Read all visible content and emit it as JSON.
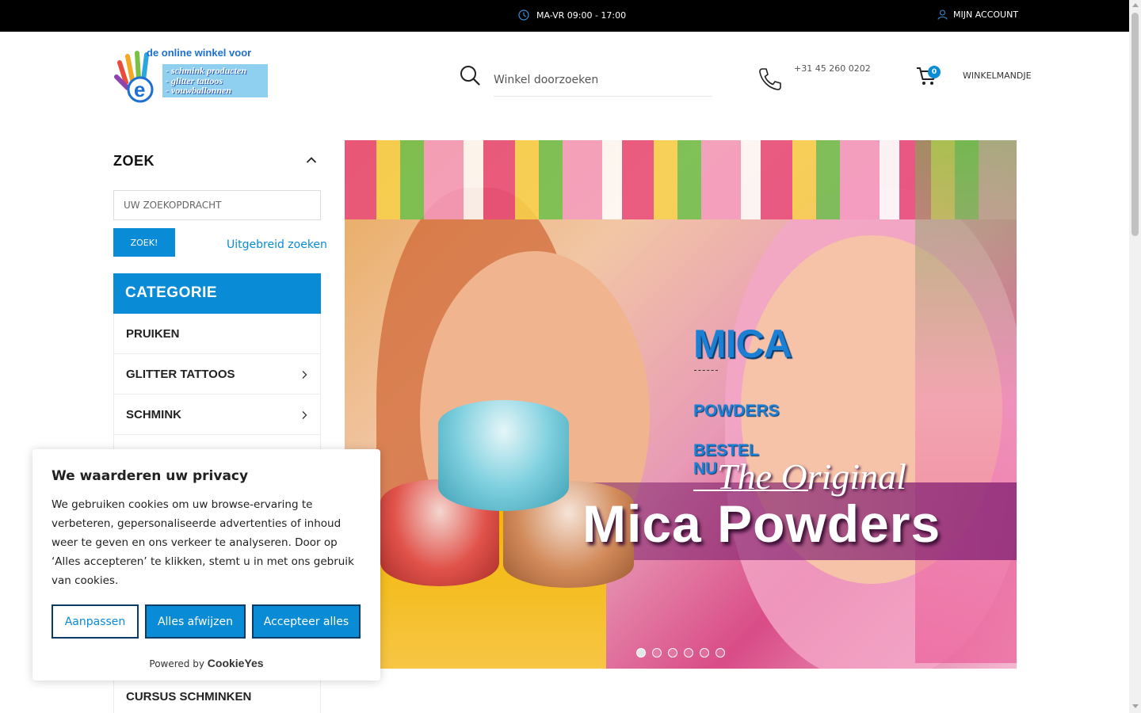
{
  "topbar": {
    "hours": "MA-VR 09:00 - 17:00",
    "account": "MIJN ACCOUNT"
  },
  "header": {
    "logo_tagline": "de online winkel voor",
    "logo_lines": [
      "- schmink producten",
      "- glitter tattoos",
      "- vouwballonnen"
    ],
    "search_placeholder": "Winkel doorzoeken",
    "phone": "+31 45 260 0202",
    "cart_count": "0",
    "cart_label": "WINKELMANDJE"
  },
  "sidebar": {
    "zoek_title": "ZOEK",
    "search_placeholder": "UW ZOEKOPDRACHT",
    "search_button": "ZOEK!",
    "advanced_link": "Uitgebreid zoeken",
    "category_title": "CATEGORIE",
    "categories": [
      {
        "label": "PRUIKEN",
        "has_children": false
      },
      {
        "label": "GLITTER TATTOOS",
        "has_children": true
      },
      {
        "label": "SCHMINK",
        "has_children": true
      }
    ],
    "last_category": "CURSUS SCHMINKEN"
  },
  "hero": {
    "headline": "MICA",
    "subline": "POWDERS",
    "cta": "BESTEL NU",
    "script_text": "The Original",
    "big_text": "Mica Powders",
    "slide_count": 6,
    "active_slide": 1
  },
  "cookie": {
    "title": "We waarderen uw privacy",
    "body": "We gebruiken cookies om uw browse-ervaring te verbeteren, gepersonaliseerde advertenties of inhoud weer te geven en ons verkeer te analyseren. Door op ‘Alles accepteren’ te klikken, stemt u in met ons gebruik van cookies.",
    "customize": "Aanpassen",
    "reject": "Alles afwijzen",
    "accept": "Accepteer alles",
    "powered_by": "Powered by",
    "brand": "CookieYes"
  },
  "colors": {
    "accent": "#0a8bd6",
    "topbar": "#000000",
    "hero_text_blue": "#1b7fd3"
  },
  "icons": {
    "hours": "clock-icon",
    "account": "user-icon",
    "search": "search-icon",
    "phone": "phone-icon",
    "cart": "cart-icon",
    "collapse": "chevron-up-icon",
    "expand": "chevron-right-icon"
  }
}
